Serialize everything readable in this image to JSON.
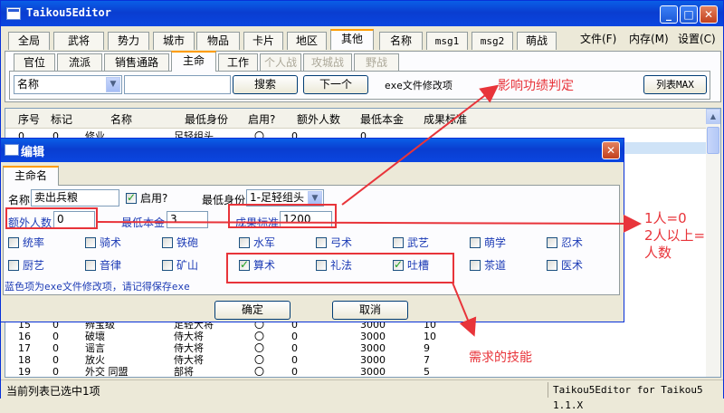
{
  "window": {
    "title": "Taikou5Editor"
  },
  "main_tabs": [
    "全局",
    "武将",
    "势力",
    "城市",
    "物品",
    "卡片",
    "地区",
    "其他",
    "名称",
    "msg1",
    "msg2",
    "萌战"
  ],
  "menu_right": [
    "文件(F)",
    "内存(M)",
    "设置(C)"
  ],
  "sub_tabs": [
    "官位",
    "流派",
    "销售通路",
    "主命",
    "工作",
    "个人战",
    "攻城战",
    "野战"
  ],
  "search": {
    "field_select": "名称",
    "search_btn": "搜索",
    "next_btn": "下一个",
    "exe_label": "exe文件修改项",
    "list_max_btn": "列表MAX"
  },
  "columns": [
    "序号",
    "标记",
    "名称",
    "最低身份",
    "启用?",
    "额外人数",
    "最低本金",
    "成果标准"
  ],
  "top_rows": [
    [
      "0",
      "0",
      "修业",
      "足轻组头",
      "〇",
      "0",
      "0",
      ""
    ]
  ],
  "bottom_rows": [
    [
      "15",
      "0",
      "辨宝级",
      "足轻大将",
      "〇",
      "0",
      "3000",
      "10"
    ],
    [
      "16",
      "0",
      "破壞",
      "侍大将",
      "〇",
      "0",
      "3000",
      "10"
    ],
    [
      "17",
      "0",
      "谣言",
      "侍大将",
      "〇",
      "0",
      "3000",
      "9"
    ],
    [
      "18",
      "0",
      "放火",
      "侍大将",
      "〇",
      "0",
      "3000",
      "7"
    ],
    [
      "19",
      "0",
      "外交 同盟",
      "部将",
      "〇",
      "0",
      "3000",
      "5"
    ]
  ],
  "status": {
    "left": "当前列表已选中1项",
    "right": "Taikou5Editor for Taikou5 1.1.X"
  },
  "dialog": {
    "title": "编辑",
    "tab": "主命名",
    "name_label": "名称",
    "name_value": "卖出兵粮",
    "enable_label": "启用?",
    "min_rank_label": "最低身份",
    "min_rank_value": "1-足轻组头",
    "extra_label": "额外人数",
    "extra_value": "0",
    "min_capital_label": "最低本金",
    "min_capital_value": "3",
    "result_label": "成果标准",
    "result_value": "1200",
    "skills_row1": [
      "统率",
      "骑术",
      "铁砲",
      "水军",
      "弓术",
      "武艺",
      "萌学",
      "忍术"
    ],
    "skills_row2": [
      "厨艺",
      "音律",
      "矿山",
      "算术",
      "礼法",
      "吐槽",
      "茶道",
      "医术"
    ],
    "skills_row2_checked": [
      false,
      false,
      false,
      true,
      false,
      true,
      false,
      false
    ],
    "note": "蓝色项为exe文件修改项，请记得保存exe",
    "ok_btn": "确定",
    "cancel_btn": "取消"
  },
  "annotations": {
    "merit": "影响功绩判定",
    "people_1": "1人=0",
    "people_2": "2人以上=",
    "people_3": "人数",
    "skills": "需求的技能"
  },
  "colors": {
    "annotation": "#e8343a",
    "titlebar": "#0a3dd0",
    "selected_row": "#cfe3f7"
  }
}
